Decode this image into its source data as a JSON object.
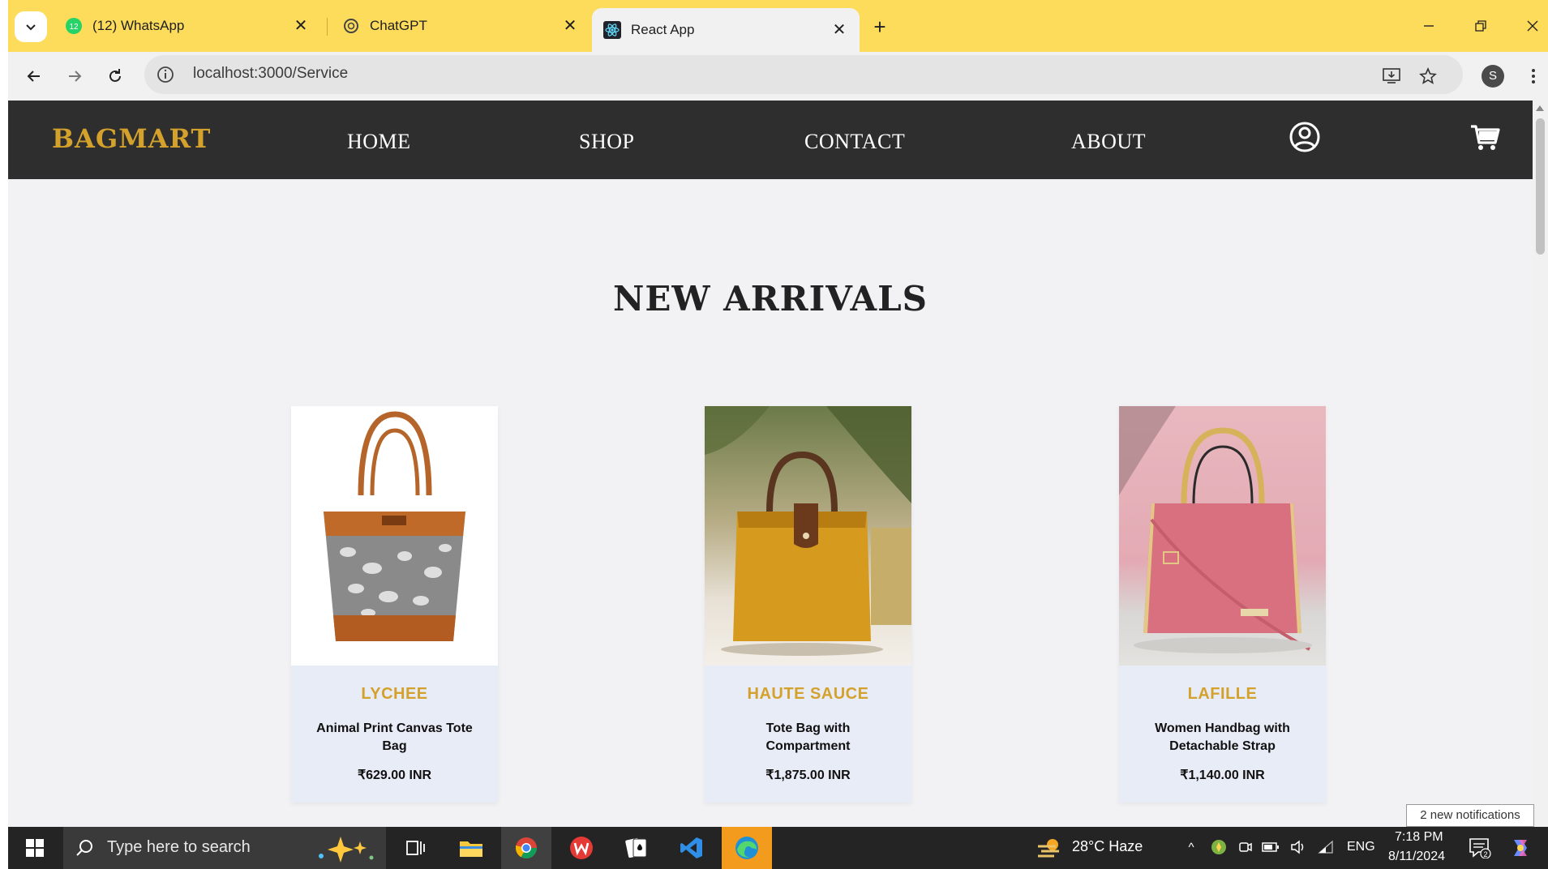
{
  "browser": {
    "tabs": [
      {
        "title": "(12) WhatsApp",
        "badge": "12",
        "active": false
      },
      {
        "title": "ChatGPT",
        "active": false
      },
      {
        "title": "React App",
        "active": true
      }
    ],
    "url": "localhost:3000/Service",
    "profile_initial": "S"
  },
  "site": {
    "brand": "BAGMART",
    "nav": [
      "HOME",
      "SHOP",
      "CONTACT",
      "ABOUT"
    ],
    "section_title": "NEW ARRIVALS",
    "products": [
      {
        "brand": "LYCHEE",
        "name": "Animal Print Canvas Tote Bag",
        "price": "₹629.00 INR"
      },
      {
        "brand": "HAUTE SAUCE",
        "name": "Tote Bag with Compartment",
        "price": "₹1,875.00 INR"
      },
      {
        "brand": "LAFILLE",
        "name": "Women Handbag with Detachable Strap",
        "price": "₹1,140.00 INR"
      }
    ]
  },
  "notification": "2 new notifications",
  "taskbar": {
    "search_placeholder": "Type here to search",
    "weather": "28°C  Haze",
    "language": "ENG",
    "time": "7:18 PM",
    "date": "8/11/2024",
    "action_center_count": "2"
  },
  "colors": {
    "tab_strip": "#fddc5c",
    "nav_bg": "#2e2e2e",
    "brand_gold": "#d4a12c",
    "page_bg": "#f2f2f4",
    "card_bg": "#e8ecf7"
  }
}
